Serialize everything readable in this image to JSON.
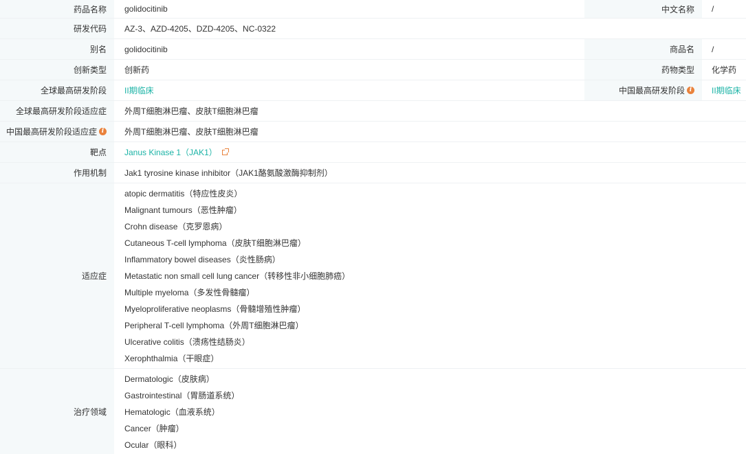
{
  "rows": {
    "drug_name": {
      "label": "药品名称",
      "value": "golidocitinib",
      "label2": "中文名称",
      "value2": "/"
    },
    "rd_code": {
      "label": "研发代码",
      "value": "AZ-3、AZD-4205、DZD-4205、NC-0322"
    },
    "alias": {
      "label": "别名",
      "value": "golidocitinib",
      "label2": "商品名",
      "value2": "/"
    },
    "innovation": {
      "label": "创新类型",
      "value": "创新药",
      "label2": "药物类型",
      "value2": "化学药"
    },
    "global_phase": {
      "label": "全球最高研发阶段",
      "value": "II期临床",
      "label2": "中国最高研发阶段",
      "value2": "II期临床",
      "info_icon": "info-icon"
    },
    "global_indication": {
      "label": "全球最高研发阶段适应症",
      "value": "外周T细胞淋巴瘤、皮肤T细胞淋巴瘤"
    },
    "china_indication": {
      "label": "中国最高研发阶段适应症",
      "value": "外周T细胞淋巴瘤、皮肤T细胞淋巴瘤",
      "info_icon": "info-icon"
    },
    "target": {
      "label": "靶点",
      "value": "Janus Kinase 1（JAK1）",
      "icon": "external-link-icon"
    },
    "mechanism": {
      "label": "作用机制",
      "value": "Jak1 tyrosine kinase inhibitor（JAK1酪氨酸激酶抑制剂）"
    },
    "indications": {
      "label": "适应症",
      "items": [
        "atopic dermatitis（特应性皮炎）",
        "Malignant tumours（恶性肿瘤）",
        "Crohn disease（克罗恩病）",
        "Cutaneous T-cell lymphoma（皮肤T细胞淋巴瘤）",
        "Inflammatory bowel diseases（炎性肠病）",
        "Metastatic non small cell lung cancer（转移性非小细胞肺癌）",
        "Multiple myeloma（多发性骨髓瘤）",
        "Myeloproliferative neoplasms（骨髓增殖性肿瘤）",
        "Peripheral T-cell lymphoma（外周T细胞淋巴瘤）",
        "Ulcerative colitis（溃疡性结肠炎）",
        "Xerophthalmia（干眼症）"
      ]
    },
    "therapeutic_area": {
      "label": "治疗领域",
      "items": [
        "Dermatologic（皮肤病）",
        "Gastrointestinal（胃肠道系统）",
        "Hematologic（血液系统）",
        "Cancer（肿瘤）",
        "Ocular（眼科）"
      ]
    }
  },
  "colors": {
    "label_bg": "#f5f9fa",
    "link": "#1bb3a6",
    "info": "#e9823c"
  }
}
